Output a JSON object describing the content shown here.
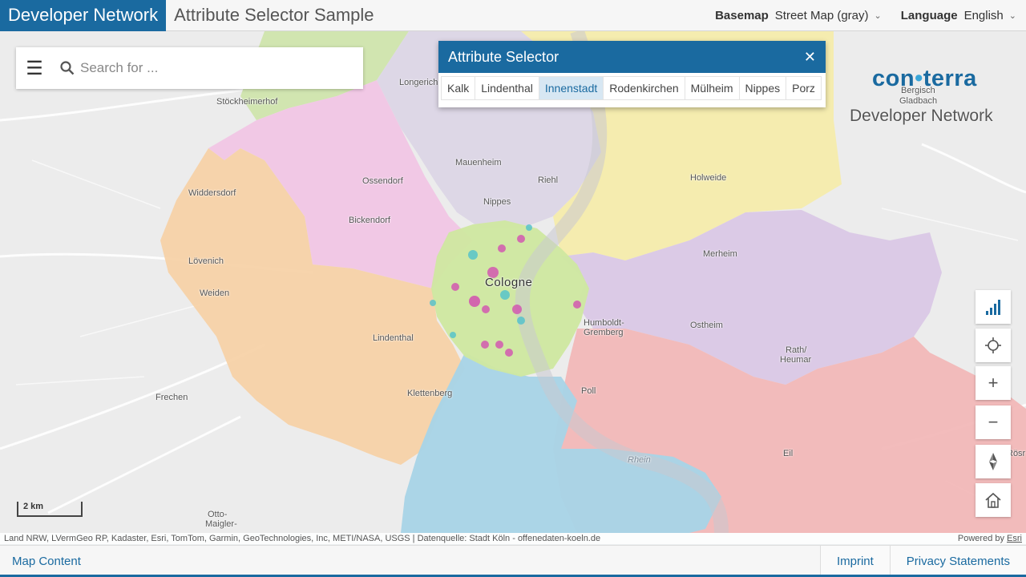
{
  "header": {
    "brand": "Developer Network",
    "title": "Attribute Selector Sample",
    "basemap_label": "Basemap",
    "basemap_value": "Street Map (gray)",
    "language_label": "Language",
    "language_value": "English"
  },
  "search": {
    "placeholder": "Search for ..."
  },
  "attribute_selector": {
    "title": "Attribute Selector",
    "tabs": [
      "Kalk",
      "Lindenthal",
      "Innenstadt",
      "Rodenkirchen",
      "Mülheim",
      "Nippes",
      "Porz"
    ],
    "active_tab": "Innenstadt"
  },
  "logo": {
    "mark_left": "con",
    "mark_dot": "•",
    "mark_right": "terra",
    "subtitle": "Developer Network"
  },
  "map": {
    "places": [
      {
        "name": "Longerich"
      },
      {
        "name": "Stöckheimerhof"
      },
      {
        "name": "Bergisch"
      },
      {
        "name": "Gladbach"
      },
      {
        "name": "Mauenheim"
      },
      {
        "name": "Riehl"
      },
      {
        "name": "Holweide"
      },
      {
        "name": "Widdersdorf"
      },
      {
        "name": "Ossendorf"
      },
      {
        "name": "Nippes"
      },
      {
        "name": "Bickendorf"
      },
      {
        "name": "Lövenich"
      },
      {
        "name": "Merheim"
      },
      {
        "name": "Weiden"
      },
      {
        "name": "Cologne"
      },
      {
        "name": "Humboldt-"
      },
      {
        "name": "Gremberg"
      },
      {
        "name": "Ostheim"
      },
      {
        "name": "Lindenthal"
      },
      {
        "name": "Rath/"
      },
      {
        "name": "Heumar"
      },
      {
        "name": "Frechen"
      },
      {
        "name": "Klettenberg"
      },
      {
        "name": "Poll"
      },
      {
        "name": "Eil"
      },
      {
        "name": "Otto-"
      },
      {
        "name": "Maigler-"
      },
      {
        "name": "Rösr"
      },
      {
        "name": "Rhein"
      }
    ],
    "scale_label": "2 km",
    "attribution": "Land NRW, LVermGeo RP, Kadaster, Esri, TomTom, Garmin, GeoTechnologies, Inc, METI/NASA, USGS | Datenquelle: Stadt Köln - offenedaten-koeln.de",
    "powered_prefix": "Powered by",
    "powered_link": "Esri"
  },
  "toolbar": {
    "chart_icon": "bar-chart-icon",
    "locate_icon": "crosshair-icon",
    "zoom_in": "+",
    "zoom_out": "−",
    "compass_icon": "compass-icon",
    "home_icon": "home-icon"
  },
  "footer": {
    "map_content": "Map Content",
    "imprint": "Imprint",
    "privacy": "Privacy Statements"
  },
  "colors": {
    "brand": "#1a6aa0",
    "innenstadt": "#cfe8a0",
    "nippes": "#dcd6e6",
    "chorweiler": "#cde4a6",
    "ehrenfeld": "#f2c4e4",
    "lindenthal": "#f7d2a8",
    "muelheim": "#f6ecac",
    "kalk": "#dac8e6",
    "rodenkirchen": "#a8d4e6",
    "porz": "#f2b8b8"
  }
}
